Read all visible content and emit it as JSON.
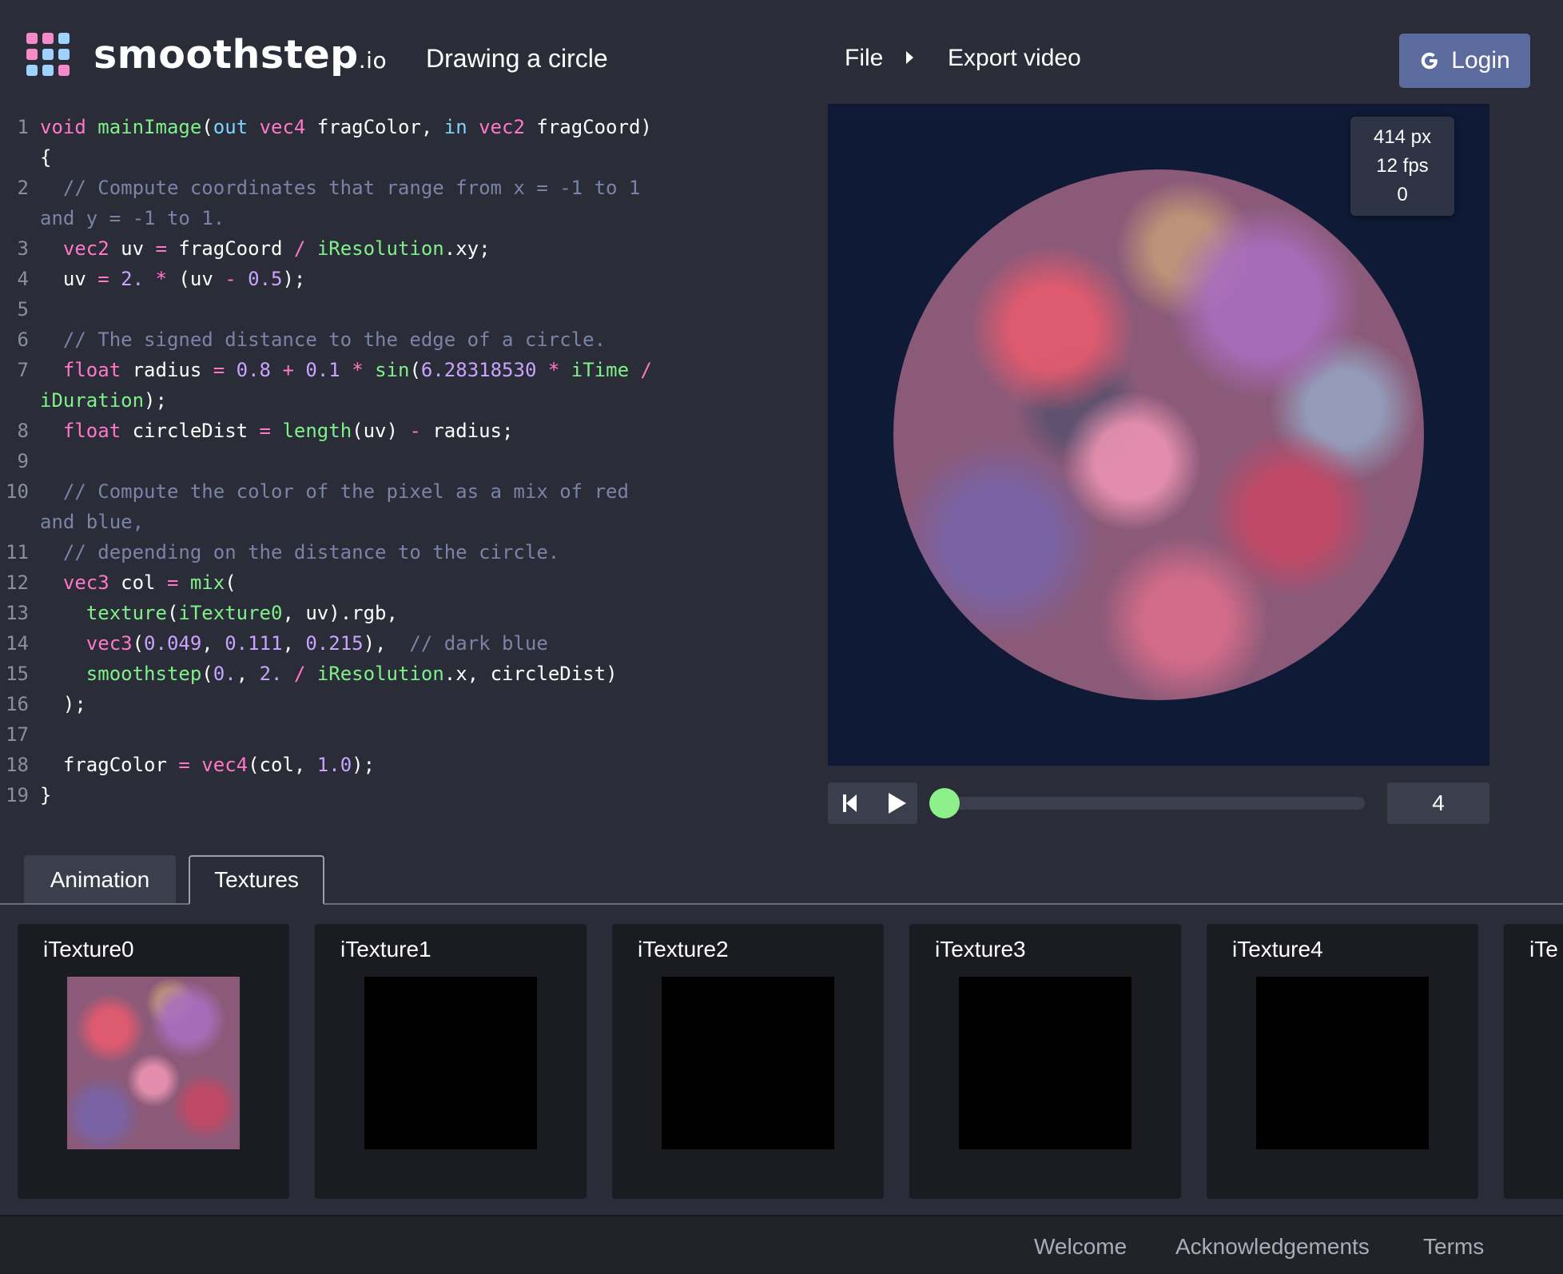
{
  "header": {
    "brand_name": "smoothstep",
    "brand_tld": ".io",
    "document_title": "Drawing a circle",
    "menu_file": "File",
    "menu_export": "Export video",
    "login_label": "Login",
    "logo_colors": [
      "#f58ac8",
      "#f58ac8",
      "#9fd3ff",
      "#f58ac8",
      "#9fd3ff",
      "#9fd3ff",
      "#9fd3ff",
      "#9fd3ff",
      "#f58ac8"
    ]
  },
  "editor": {
    "lines": [
      {
        "n": "1",
        "src": [
          [
            "kw",
            "void"
          ],
          [
            "",
            ""
          ],
          [
            "fn",
            " mainImage"
          ],
          [
            "",
            "("
          ],
          [
            "bl",
            "out"
          ],
          [
            "",
            " "
          ],
          [
            "ty",
            "vec4"
          ],
          [
            "",
            " fragColor, "
          ],
          [
            "bl",
            "in"
          ],
          [
            "",
            " "
          ],
          [
            "ty",
            "vec2"
          ],
          [
            "",
            " fragCoord)"
          ]
        ]
      },
      {
        "n": "",
        "src": [
          [
            "",
            "{"
          ]
        ]
      },
      {
        "n": "2",
        "src": [
          [
            "cm",
            "  // Compute coordinates that range from x = -1 to 1"
          ]
        ]
      },
      {
        "n": "",
        "src": [
          [
            "cm",
            "and y = -1 to 1."
          ]
        ]
      },
      {
        "n": "3",
        "src": [
          [
            "ty",
            "  vec2"
          ],
          [
            "",
            " uv "
          ],
          [
            "op",
            "="
          ],
          [
            "",
            " fragCoord "
          ],
          [
            "op",
            "/"
          ],
          [
            "",
            " "
          ],
          [
            "fn",
            "iResolution"
          ],
          [
            "",
            ".xy;"
          ]
        ]
      },
      {
        "n": "4",
        "src": [
          [
            "",
            "  uv "
          ],
          [
            "op",
            "="
          ],
          [
            "",
            " "
          ],
          [
            "nm",
            "2."
          ],
          [
            "",
            " "
          ],
          [
            "op",
            "*"
          ],
          [
            "",
            " (uv "
          ],
          [
            "op",
            "-"
          ],
          [
            "",
            " "
          ],
          [
            "nm",
            "0.5"
          ],
          [
            "",
            ");"
          ]
        ]
      },
      {
        "n": "5",
        "src": [
          [
            "",
            ""
          ]
        ]
      },
      {
        "n": "6",
        "src": [
          [
            "cm",
            "  // The signed distance to the edge of a circle."
          ]
        ]
      },
      {
        "n": "7",
        "src": [
          [
            "ty",
            "  float"
          ],
          [
            "",
            " radius "
          ],
          [
            "op",
            "="
          ],
          [
            "",
            " "
          ],
          [
            "nm",
            "0.8"
          ],
          [
            "",
            " "
          ],
          [
            "op",
            "+"
          ],
          [
            "",
            " "
          ],
          [
            "nm",
            "0.1"
          ],
          [
            "",
            " "
          ],
          [
            "op",
            "*"
          ],
          [
            "",
            " "
          ],
          [
            "fn",
            "sin"
          ],
          [
            "",
            "("
          ],
          [
            "nm",
            "6.28318530"
          ],
          [
            "",
            " "
          ],
          [
            "op",
            "*"
          ],
          [
            "",
            " "
          ],
          [
            "fn",
            "iTime"
          ],
          [
            "",
            " "
          ],
          [
            "op",
            "/"
          ]
        ]
      },
      {
        "n": "",
        "src": [
          [
            "fn",
            "iDuration"
          ],
          [
            "",
            ");"
          ]
        ]
      },
      {
        "n": "8",
        "src": [
          [
            "ty",
            "  float"
          ],
          [
            "",
            " circleDist "
          ],
          [
            "op",
            "="
          ],
          [
            "",
            " "
          ],
          [
            "fn",
            "length"
          ],
          [
            "",
            "(uv) "
          ],
          [
            "op",
            "-"
          ],
          [
            "",
            " radius;"
          ]
        ]
      },
      {
        "n": "9",
        "src": [
          [
            "",
            ""
          ]
        ]
      },
      {
        "n": "10",
        "src": [
          [
            "cm",
            "  // Compute the color of the pixel as a mix of red"
          ]
        ]
      },
      {
        "n": "",
        "src": [
          [
            "cm",
            "and blue,"
          ]
        ]
      },
      {
        "n": "11",
        "src": [
          [
            "cm",
            "  // depending on the distance to the circle."
          ]
        ]
      },
      {
        "n": "12",
        "src": [
          [
            "ty",
            "  vec3"
          ],
          [
            "",
            " col "
          ],
          [
            "op",
            "="
          ],
          [
            "",
            " "
          ],
          [
            "fn",
            "mix"
          ],
          [
            "",
            "("
          ]
        ]
      },
      {
        "n": "13",
        "src": [
          [
            "fn",
            "    texture"
          ],
          [
            "",
            "("
          ],
          [
            "fn",
            "iTexture0"
          ],
          [
            "",
            ", uv).rgb,"
          ]
        ]
      },
      {
        "n": "14",
        "src": [
          [
            "ty",
            "    vec3"
          ],
          [
            "",
            "("
          ],
          [
            "nm",
            "0.049"
          ],
          [
            "",
            ", "
          ],
          [
            "nm",
            "0.111"
          ],
          [
            "",
            ", "
          ],
          [
            "nm",
            "0.215"
          ],
          [
            "",
            "),  "
          ],
          [
            "cm",
            "// dark blue"
          ]
        ]
      },
      {
        "n": "15",
        "src": [
          [
            "fn",
            "    smoothstep"
          ],
          [
            "",
            "("
          ],
          [
            "nm",
            "0."
          ],
          [
            "",
            ", "
          ],
          [
            "nm",
            "2."
          ],
          [
            "",
            " "
          ],
          [
            "op",
            "/"
          ],
          [
            "",
            " "
          ],
          [
            "fn",
            "iResolution"
          ],
          [
            "",
            ".x, circleDist)"
          ]
        ]
      },
      {
        "n": "16",
        "src": [
          [
            "",
            "  );"
          ]
        ]
      },
      {
        "n": "17",
        "src": [
          [
            "",
            ""
          ]
        ]
      },
      {
        "n": "18",
        "src": [
          [
            "",
            "  fragColor "
          ],
          [
            "op",
            "="
          ],
          [
            "",
            " "
          ],
          [
            "ty",
            "vec4"
          ],
          [
            "",
            "(col, "
          ],
          [
            "nm",
            "1.0"
          ],
          [
            "",
            ");"
          ]
        ]
      },
      {
        "n": "19",
        "src": [
          [
            "",
            "}"
          ]
        ]
      }
    ]
  },
  "preview": {
    "stats_resolution": "414 px",
    "stats_fps": "12 fps",
    "stats_frame": "0",
    "background_color": "#0f1a36"
  },
  "playback": {
    "skip_icon": "skip-to-start-icon",
    "play_icon": "play-icon",
    "progress": 0.0,
    "frame_value": "4",
    "accent_color": "#8ef08a"
  },
  "tabs": [
    {
      "label": "Animation",
      "active": false
    },
    {
      "label": "Textures",
      "active": true
    }
  ],
  "textures": [
    {
      "label": "iTexture0",
      "has_image": true
    },
    {
      "label": "iTexture1",
      "has_image": false
    },
    {
      "label": "iTexture2",
      "has_image": false
    },
    {
      "label": "iTexture3",
      "has_image": false
    },
    {
      "label": "iTexture4",
      "has_image": false
    },
    {
      "label": "iTe",
      "has_image": false
    }
  ],
  "footer": {
    "welcome": "Welcome",
    "acknowledgements": "Acknowledgements",
    "terms": "Terms"
  }
}
